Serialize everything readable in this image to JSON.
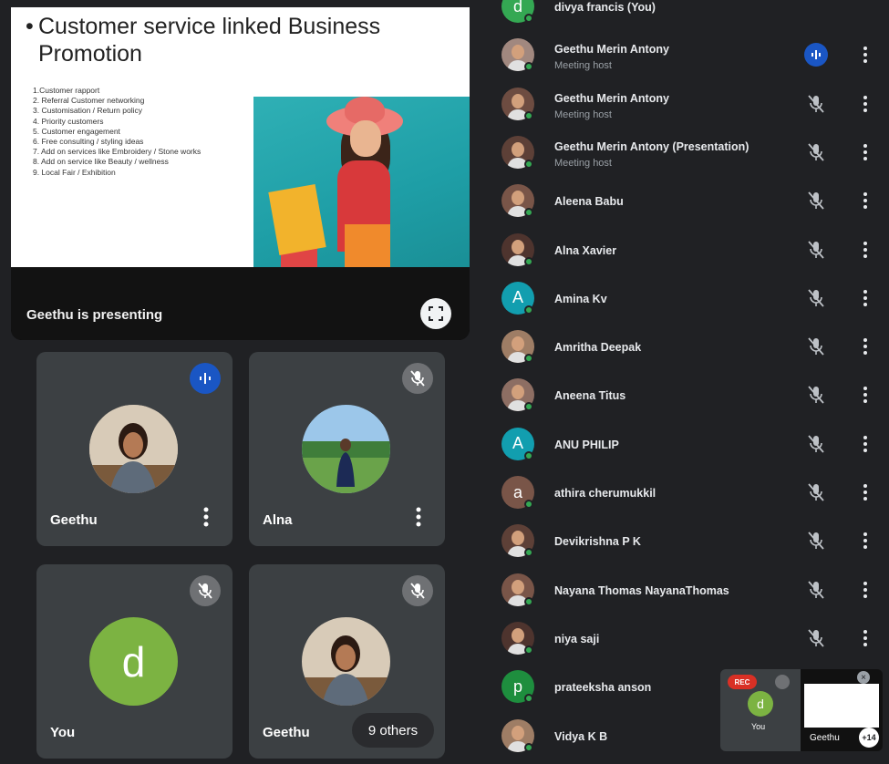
{
  "presentation": {
    "slide_title": "Customer service linked Business Promotion",
    "slide_items": [
      "1.Customer rapport",
      "2. Referral Customer networking",
      "3. Customisation / Return policy",
      "4. Priority customers",
      "5. Customer engagement",
      "6. Free consulting / styling ideas",
      "7. Add on services like Embroidery / Stone works",
      "8. Add on service like Beauty / wellness",
      "9. Local Fair / Exhibition"
    ],
    "presenting_label": "Geethu is presenting"
  },
  "tiles": [
    {
      "name": "Geethu",
      "status": "speaking"
    },
    {
      "name": "Alna",
      "status": "muted"
    },
    {
      "name": "You",
      "status": "muted",
      "avatar_letter": "d"
    },
    {
      "name": "Geethu",
      "status": "muted",
      "others_label": "9 others"
    }
  ],
  "participants": [
    {
      "name": "divya francis (You)",
      "avatar": "d",
      "color": "#34a853"
    },
    {
      "name": "Geethu Merin Antony",
      "sub": "Meeting host",
      "mic": "speaking"
    },
    {
      "name": "Geethu Merin Antony",
      "sub": "Meeting host",
      "mic": "muted"
    },
    {
      "name": "Geethu Merin Antony (Presentation)",
      "sub": "Meeting host",
      "mic": "muted"
    },
    {
      "name": "Aleena Babu",
      "mic": "muted"
    },
    {
      "name": "Alna Xavier",
      "mic": "muted"
    },
    {
      "name": "Amina Kv",
      "avatar": "A",
      "color": "#129eaf",
      "mic": "muted"
    },
    {
      "name": "Amritha Deepak",
      "mic": "muted"
    },
    {
      "name": "Aneena Titus",
      "mic": "muted"
    },
    {
      "name": "ANU PHILIP",
      "avatar": "A",
      "color": "#129eaf",
      "mic": "muted"
    },
    {
      "name": "athira cherumukkil",
      "avatar": "a",
      "color": "#795548",
      "mic": "muted"
    },
    {
      "name": "Devikrishna P K",
      "mic": "muted"
    },
    {
      "name": "Nayana Thomas NayanaThomas",
      "mic": "muted"
    },
    {
      "name": "niya saji",
      "mic": "muted"
    },
    {
      "name": "prateeksha anson",
      "avatar": "p",
      "color": "#1e8e3e",
      "mic": ""
    },
    {
      "name": "Vidya K B",
      "mic": ""
    }
  ],
  "mini_preview": {
    "self_label": "You",
    "self_letter": "d",
    "rec_label": "REC",
    "count_label": "+14",
    "name_label": "Geethu"
  },
  "colors": {
    "background": "#202124",
    "tile": "#3c4043",
    "accent_blue": "#1a56c4",
    "self_avatar": "#7cb342",
    "online_dot": "#34a853"
  }
}
